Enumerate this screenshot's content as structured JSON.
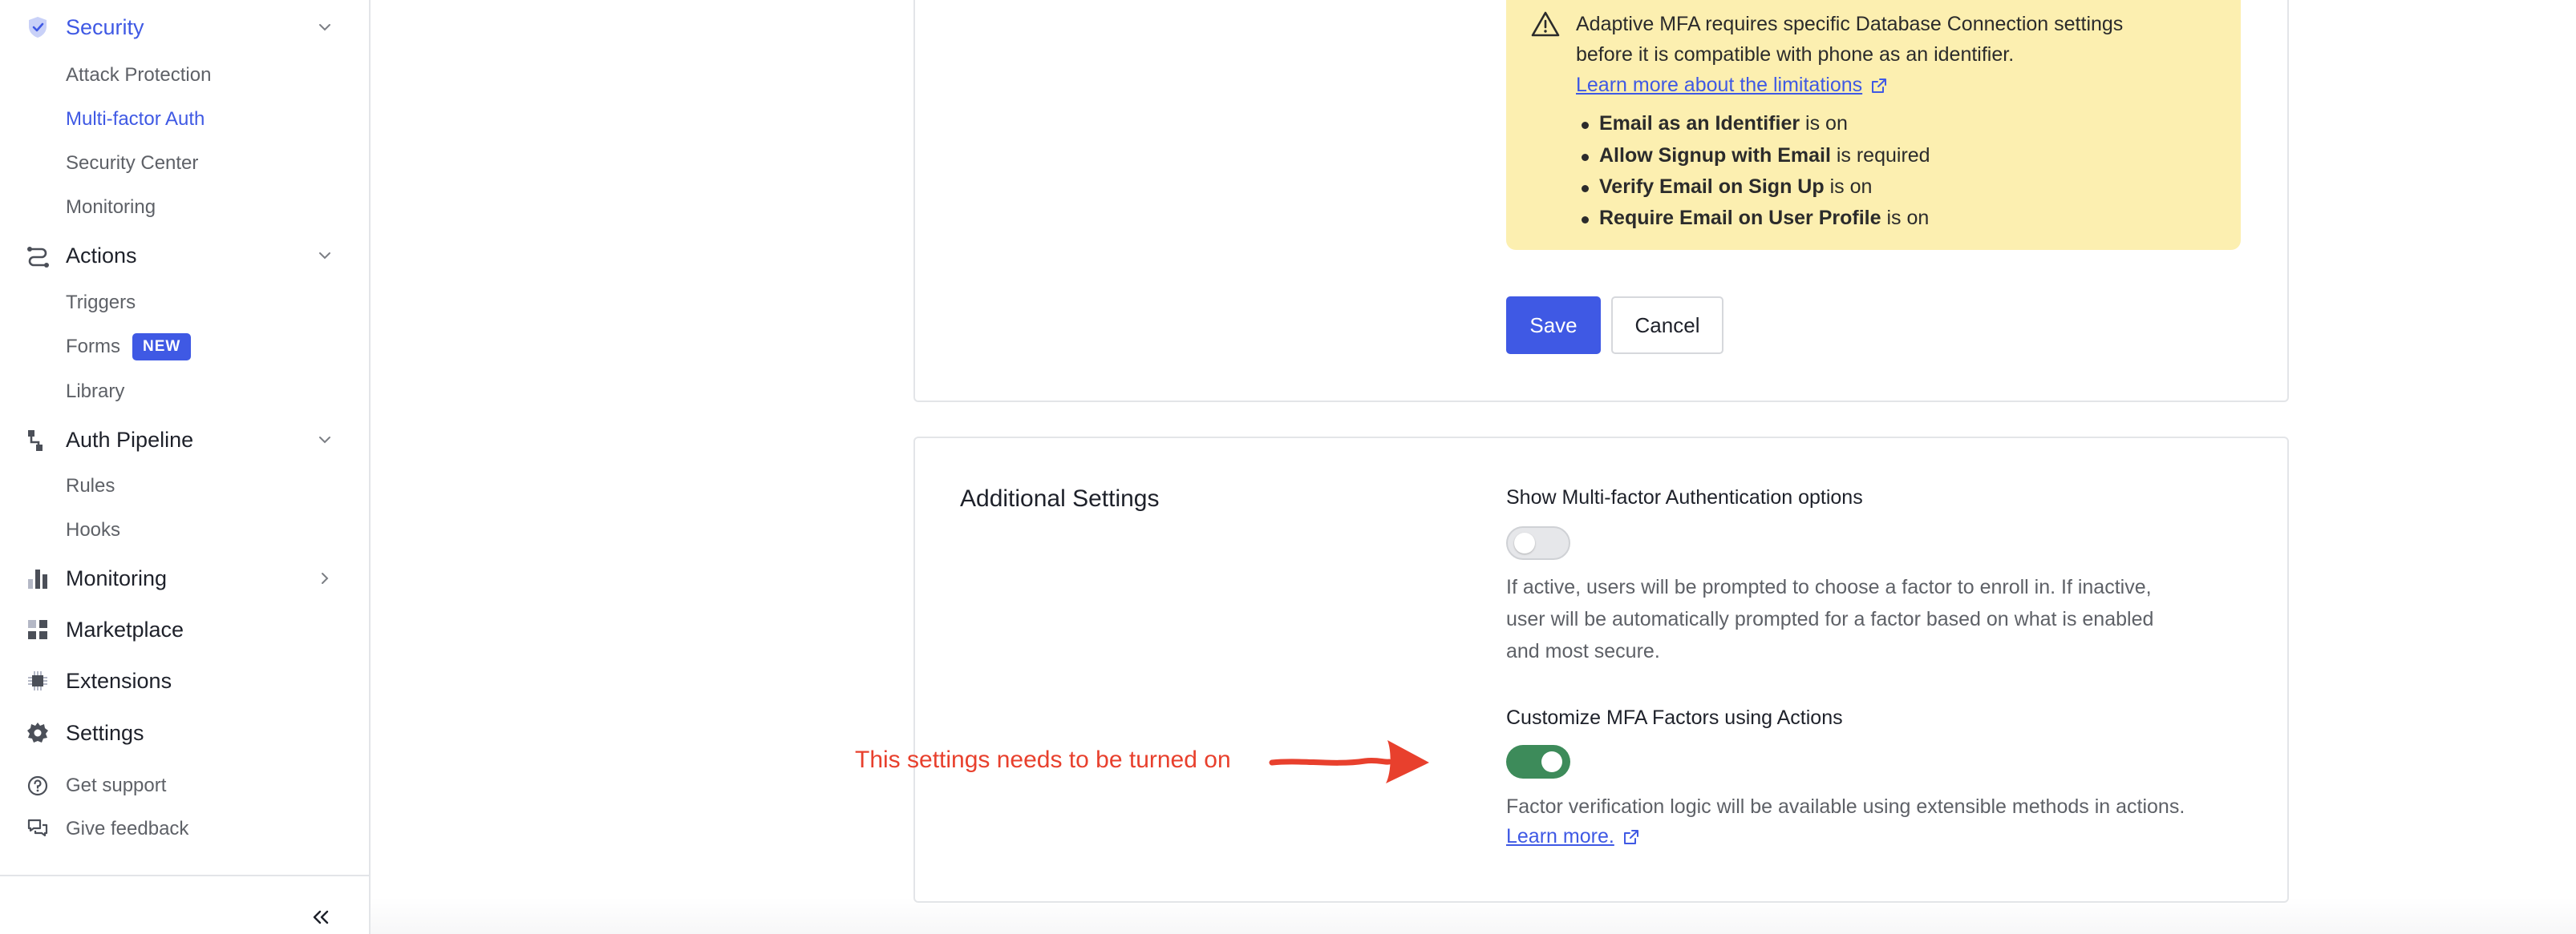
{
  "sidebar": {
    "sections": {
      "security": {
        "label": "Security",
        "icon": "shield-check-icon"
      },
      "attack_protection": {
        "label": "Attack Protection"
      },
      "multi_factor": {
        "label": "Multi-factor Auth"
      },
      "security_center": {
        "label": "Security Center"
      },
      "monitoring_sub": {
        "label": "Monitoring"
      },
      "actions": {
        "label": "Actions",
        "icon": "actions-flow-icon"
      },
      "triggers": {
        "label": "Triggers"
      },
      "forms": {
        "label": "Forms",
        "badge": "NEW"
      },
      "library": {
        "label": "Library"
      },
      "auth_pipeline": {
        "label": "Auth Pipeline",
        "icon": "pipeline-icon"
      },
      "rules": {
        "label": "Rules"
      },
      "hooks": {
        "label": "Hooks"
      },
      "monitoring": {
        "label": "Monitoring",
        "icon": "bar-chart-icon"
      },
      "marketplace": {
        "label": "Marketplace",
        "icon": "marketplace-grid-icon"
      },
      "extensions": {
        "label": "Extensions",
        "icon": "chip-icon"
      },
      "settings": {
        "label": "Settings",
        "icon": "gear-icon"
      }
    },
    "utility": {
      "support": {
        "label": "Get support",
        "icon": "question-circle-icon"
      },
      "feedback": {
        "label": "Give feedback",
        "icon": "feedback-chat-icon"
      }
    },
    "collapse_icon": "double-chevron-left-icon"
  },
  "warning": {
    "line1": "Adaptive MFA requires specific Database Connection settings",
    "line2": "before it is compatible with phone as an identifier.",
    "link": "Learn more about the limitations",
    "bullets": [
      {
        "bold": "Email as an Identifier",
        "rest": " is on"
      },
      {
        "bold": "Allow Signup with Email",
        "rest": " is required"
      },
      {
        "bold": "Verify Email on Sign Up",
        "rest": " is on"
      },
      {
        "bold": "Require Email on User Profile",
        "rest": " is on"
      }
    ]
  },
  "buttons": {
    "save": "Save",
    "cancel": "Cancel"
  },
  "additional": {
    "title": "Additional Settings",
    "show_mfa": {
      "title": "Show Multi-factor Authentication options",
      "enabled": false,
      "desc_line1": "If active, users will be prompted to choose a factor to enroll in. If inactive,",
      "desc_line2": "user will be automatically prompted for a factor based on what is enabled",
      "desc_line3": "and most secure."
    },
    "customize": {
      "title": "Customize MFA Factors using Actions",
      "enabled": true,
      "desc": "Factor verification logic will be available using extensible methods in actions.",
      "link": "Learn more."
    }
  },
  "annotation": {
    "text": "This settings needs to be turned on"
  },
  "colors": {
    "accent": "#3f59e4",
    "toggle_on": "#3d8b5a",
    "warning_bg": "#fcefb0",
    "annotation": "#e8402d"
  }
}
